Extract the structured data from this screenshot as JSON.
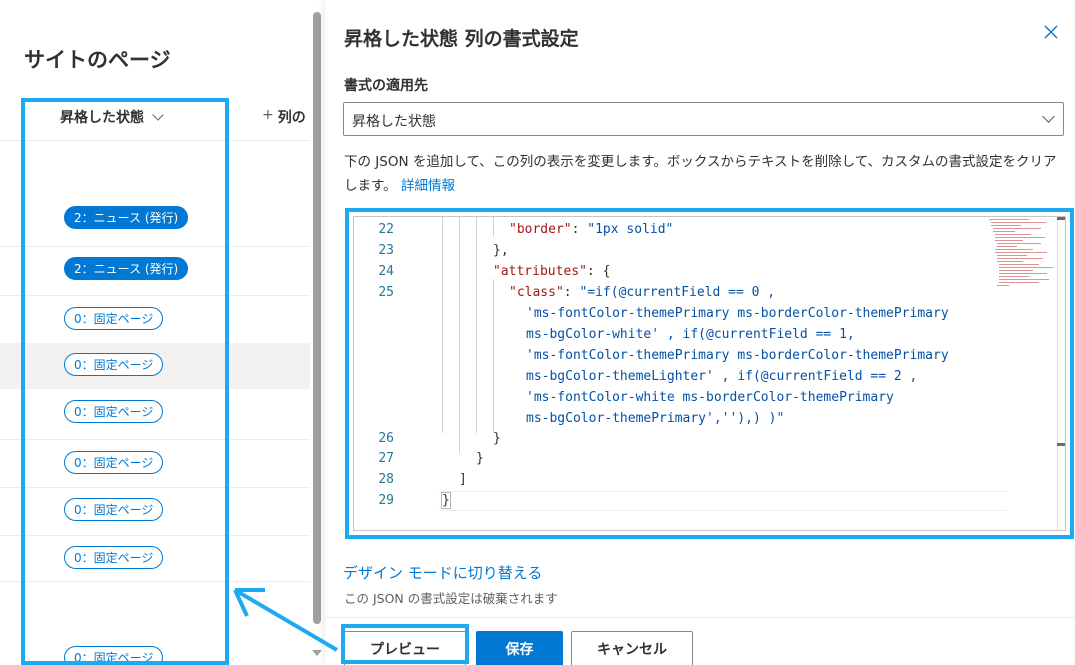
{
  "site": {
    "title": "サイトのページ"
  },
  "list": {
    "column_header": "昇格した状態",
    "add_column": "列の",
    "rows": [
      {
        "label": "2：ニュース (発行)",
        "style": "solid"
      },
      {
        "label": "2：ニュース (発行)",
        "style": "solid"
      },
      {
        "label": "0：固定ページ",
        "style": "outline"
      },
      {
        "label": "0：固定ページ",
        "style": "outline"
      },
      {
        "label": "0：固定ページ",
        "style": "outline"
      },
      {
        "label": "0：固定ページ",
        "style": "outline"
      },
      {
        "label": "0：固定ページ",
        "style": "outline"
      },
      {
        "label": "0：固定ページ",
        "style": "outline"
      },
      {
        "label": "0：固定ページ",
        "style": "outline"
      }
    ]
  },
  "panel": {
    "title": "昇格した状態 列の書式設定",
    "apply_label": "書式の適用先",
    "apply_value": "昇格した状態",
    "description": "下の JSON を追加して、この列の表示を変更します。ボックスからテキストを削除して、カスタムの書式設定をクリアします。",
    "details_link": "詳細情報",
    "switch_link": "デザイン モードに切り替える",
    "discard_note": "この JSON の書式設定は破棄されます",
    "buttons": {
      "preview": "プレビュー",
      "save": "保存",
      "cancel": "キャンセル"
    }
  },
  "editor": {
    "line_numbers": [
      "22",
      "23",
      "24",
      "25",
      "26",
      "27",
      "28",
      "29"
    ],
    "lines": {
      "l22_key": "\"border\"",
      "l22_rest": ": ",
      "l22_val": "\"1px solid\"",
      "l23": "},",
      "l24_key": "\"attributes\"",
      "l24_rest": ": {",
      "l25_key": "\"class\"",
      "l25_rest": ": ",
      "l25_val_1": "\"=if(@currentField == 0 ,",
      "l25_val_2": "'ms-fontColor-themePrimary ms-borderColor-themePrimary",
      "l25_val_3": "ms-bgColor-white' , if(@currentField == 1,",
      "l25_val_4": "'ms-fontColor-themePrimary ms-borderColor-themePrimary",
      "l25_val_5": "ms-bgColor-themeLighter' , if(@currentField == 2 ,",
      "l25_val_6": "'ms-fontColor-white ms-borderColor-themePrimary",
      "l25_val_7": "ms-bgColor-themePrimary',''),) )\"",
      "l26": "}",
      "l27": "}",
      "l28": "]",
      "l29": "}"
    }
  },
  "colors": {
    "accent": "#0078d4",
    "highlight": "#1eaaf1",
    "json_key": "#a31515",
    "json_string": "#0451a5",
    "line_number": "#237893"
  },
  "icons": [
    "chevron-down-icon",
    "plus-icon",
    "close-icon"
  ]
}
